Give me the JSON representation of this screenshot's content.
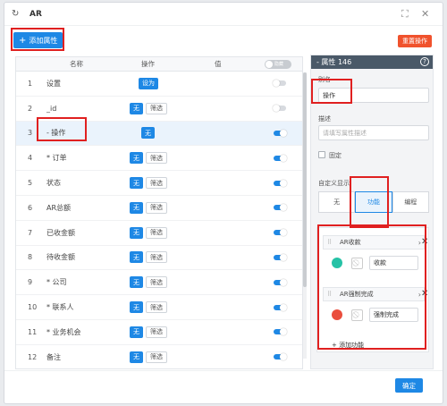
{
  "window": {
    "title": "AR",
    "refresh_icon": "refresh-icon",
    "expand_icon": "expand-icon",
    "close_icon": "close-icon"
  },
  "toolbar": {
    "add_attr_label": "添加属性",
    "reset_label": "重置操作"
  },
  "table": {
    "headers": {
      "name": "名称",
      "op": "操作",
      "value": "值"
    },
    "master_toggle_label": "隐藏",
    "rows": [
      {
        "idx": "1",
        "name": "设置",
        "tags": [
          "设为"
        ],
        "toggle": "off"
      },
      {
        "idx": "2",
        "name": "_id",
        "tags": [
          "无",
          "筛选"
        ],
        "toggle": "off"
      },
      {
        "idx": "3",
        "name": "- 操作",
        "tags": [
          "无"
        ],
        "toggle": "on"
      },
      {
        "idx": "4",
        "name": "* 订单",
        "tags": [
          "无",
          "筛选"
        ],
        "toggle": "on"
      },
      {
        "idx": "5",
        "name": "状态",
        "tags": [
          "无",
          "筛选"
        ],
        "toggle": "on"
      },
      {
        "idx": "6",
        "name": "AR总额",
        "tags": [
          "无",
          "筛选"
        ],
        "toggle": "on"
      },
      {
        "idx": "7",
        "name": "已收金额",
        "tags": [
          "无",
          "筛选"
        ],
        "toggle": "on"
      },
      {
        "idx": "8",
        "name": "待收金额",
        "tags": [
          "无",
          "筛选"
        ],
        "toggle": "on"
      },
      {
        "idx": "9",
        "name": "* 公司",
        "tags": [
          "无",
          "筛选"
        ],
        "toggle": "on"
      },
      {
        "idx": "10",
        "name": "* 联系人",
        "tags": [
          "无",
          "筛选"
        ],
        "toggle": "on"
      },
      {
        "idx": "11",
        "name": "* 业务机会",
        "tags": [
          "无",
          "筛选"
        ],
        "toggle": "on"
      },
      {
        "idx": "12",
        "name": "备注",
        "tags": [
          "无",
          "筛选"
        ],
        "toggle": "on"
      }
    ]
  },
  "panel": {
    "title": "- 属性 146",
    "alias_label": "别名",
    "alias_value": "操作",
    "desc_label": "描述",
    "desc_placeholder": "请填写属性描述",
    "fixed_label": "固定",
    "display_label": "自定义显示",
    "seg_options": [
      "无",
      "功能",
      "编程"
    ],
    "functions": [
      {
        "name": "AR收款",
        "value": "收款",
        "color": "#26c2a6"
      },
      {
        "name": "AR强制完成",
        "value": "强制完成",
        "color": "#ea4e3d"
      }
    ],
    "add_function_label": "添加功能"
  },
  "footer": {
    "ok_label": "确定"
  }
}
